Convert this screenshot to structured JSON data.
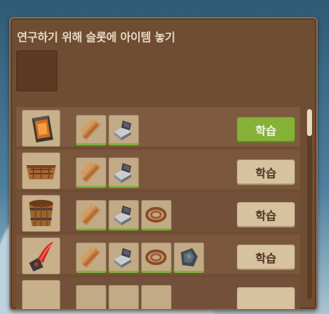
{
  "panel": {
    "title": "연구하기 위해 슬롯에 아이템 놓기"
  },
  "learn_label": "학습",
  "rows": [
    {
      "item_icon": "scrap-hook-icon",
      "costs": [
        "plank-icon",
        "scrap-icon"
      ],
      "button": "학습",
      "state": "available"
    },
    {
      "item_icon": "wooden-crate-icon",
      "costs": [
        "plank-icon",
        "scrap-icon"
      ],
      "button": "학습",
      "state": "locked"
    },
    {
      "item_icon": "wooden-bucket-icon",
      "costs": [
        "plank-icon",
        "scrap-icon",
        "rope-icon"
      ],
      "button": "학습",
      "state": "locked"
    },
    {
      "item_icon": "red-fishing-tool-icon",
      "costs": [
        "plank-icon",
        "scrap-icon",
        "rope-icon",
        "metal-ore-icon"
      ],
      "button": "학습",
      "state": "locked"
    }
  ],
  "colors": {
    "panel": "#6f4d33",
    "learn_active": "#86b238",
    "learn_inactive": "#d6c29e",
    "cost_border": "#7db33b"
  }
}
